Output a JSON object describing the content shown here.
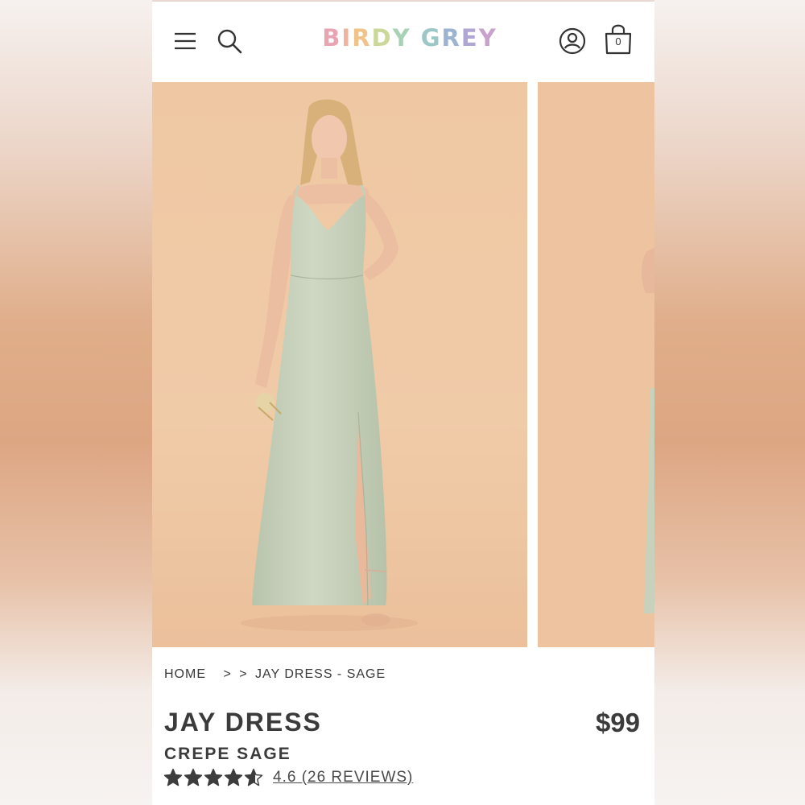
{
  "brand": {
    "logo_letters": [
      {
        "ch": "B",
        "color": "#e8a4b3"
      },
      {
        "ch": "I",
        "color": "#eeb39a"
      },
      {
        "ch": "R",
        "color": "#f0c489"
      },
      {
        "ch": "D",
        "color": "#cbd89a"
      },
      {
        "ch": "Y",
        "color": "#a7d3b4"
      },
      {
        "ch": " ",
        "color": "#ffffff"
      },
      {
        "ch": "G",
        "color": "#9bc7c6"
      },
      {
        "ch": "R",
        "color": "#9cb3d1"
      },
      {
        "ch": "E",
        "color": "#b0a6d3"
      },
      {
        "ch": "Y",
        "color": "#c8a2cc"
      }
    ]
  },
  "header": {
    "bag_count": "0",
    "icons": [
      "menu-icon",
      "search-icon",
      "account-icon",
      "shopping-bag-icon"
    ]
  },
  "breadcrumb": {
    "home": "HOME",
    "separator": ">",
    "current": "JAY DRESS - SAGE"
  },
  "product": {
    "title": "JAY DRESS",
    "subtitle": "CREPE SAGE",
    "price": "$99",
    "rating_text": "4.6 (26 REVIEWS)",
    "rating_value": 4.6,
    "rating_max": 5
  },
  "colors": {
    "dress": "#c9d3bd",
    "backdrop": "#eec4a0",
    "text": "#3b3b3b"
  }
}
